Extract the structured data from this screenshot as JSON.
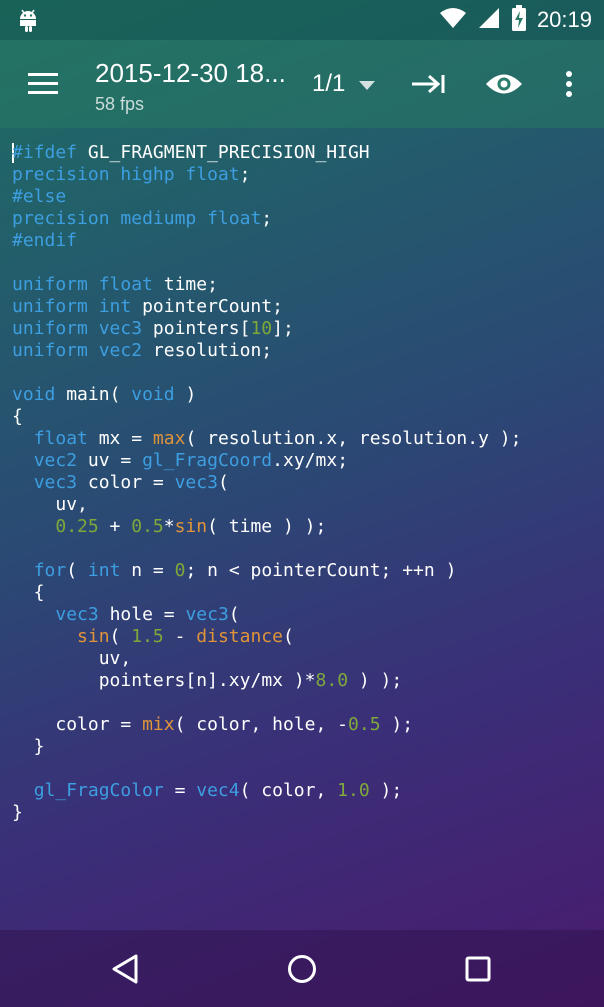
{
  "status_bar": {
    "time": "20:19",
    "icons": [
      "android-icon",
      "wifi-icon",
      "signal-icon",
      "battery-charging-icon"
    ]
  },
  "toolbar": {
    "title": "2015-12-30 18...",
    "subtitle": "58 fps",
    "pager": "1/1",
    "icons": [
      "menu-icon",
      "dropdown-arrow-icon",
      "insert-tab-icon",
      "eye-icon",
      "more-vert-icon"
    ]
  },
  "editor": {
    "lines": [
      "#ifdef GL_FRAGMENT_PRECISION_HIGH",
      "precision highp float;",
      "#else",
      "precision mediump float;",
      "#endif",
      "",
      "uniform float time;",
      "uniform int pointerCount;",
      "uniform vec3 pointers[10];",
      "uniform vec2 resolution;",
      "",
      "void main( void )",
      "{",
      "  float mx = max( resolution.x, resolution.y );",
      "  vec2 uv = gl_FragCoord.xy/mx;",
      "  vec3 color = vec3(",
      "    uv,",
      "    0.25 + 0.5*sin( time ) );",
      "",
      "  for( int n = 0; n < pointerCount; ++n )",
      "  {",
      "    vec3 hole = vec3(",
      "      sin( 1.5 - distance(",
      "        uv,",
      "        pointers[n].xy/mx )*8.0 ) );",
      "",
      "    color = mix( color, hole, -0.5 );",
      "  }",
      "",
      "  gl_FragColor = vec4( color, 1.0 );",
      "}"
    ],
    "colors": {
      "keyword": "#3d9ee0",
      "function": "#e0943a",
      "number": "#7fa83a",
      "text": "#ffffff"
    }
  },
  "nav_bar": {
    "icons": [
      "back-icon",
      "home-icon",
      "recents-icon"
    ]
  }
}
